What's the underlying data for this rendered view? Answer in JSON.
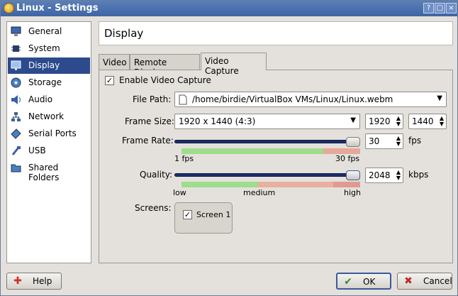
{
  "window": {
    "title": "Linux - Settings"
  },
  "sidebar": {
    "items": [
      {
        "label": "General",
        "icon": "monitor-icon"
      },
      {
        "label": "System",
        "icon": "chip-icon"
      },
      {
        "label": "Display",
        "icon": "display-icon",
        "active": true
      },
      {
        "label": "Storage",
        "icon": "disk-icon"
      },
      {
        "label": "Audio",
        "icon": "speaker-icon"
      },
      {
        "label": "Network",
        "icon": "network-icon"
      },
      {
        "label": "Serial Ports",
        "icon": "serial-icon"
      },
      {
        "label": "USB",
        "icon": "usb-icon"
      },
      {
        "label": "Shared Folders",
        "icon": "folder-icon"
      }
    ]
  },
  "header": {
    "title": "Display"
  },
  "tabs": [
    {
      "label": "Video"
    },
    {
      "label": "Remote Display"
    },
    {
      "label": "Video Capture",
      "active": true
    }
  ],
  "capture": {
    "enable_label": "Enable Video Capture",
    "enabled": true,
    "file_path_label": "File Path:",
    "file_path": "/home/birdie/VirtualBox VMs/Linux/Linux.webm",
    "frame_size_label": "Frame Size:",
    "frame_size": "1920 x 1440 (4:3)",
    "frame_width": "1920",
    "frame_height": "1440",
    "frame_rate_label": "Frame Rate:",
    "frame_rate": "30",
    "frame_rate_unit": "fps",
    "frame_rate_min": "1 fps",
    "frame_rate_max": "30 fps",
    "frame_rate_level": 1.0,
    "quality_label": "Quality:",
    "quality": "2048",
    "quality_unit": "kbps",
    "quality_low": "low",
    "quality_medium": "medium",
    "quality_high": "high",
    "quality_level": 1.0,
    "screens_label": "Screens:",
    "screen1_label": "Screen 1",
    "screen1_checked": true
  },
  "buttons": {
    "help": "Help",
    "ok": "OK",
    "cancel": "Cancel"
  },
  "colors": {
    "accent": "#2c4a8c",
    "scale_green": "#9fdc8c",
    "scale_red": "#e6a89a"
  }
}
